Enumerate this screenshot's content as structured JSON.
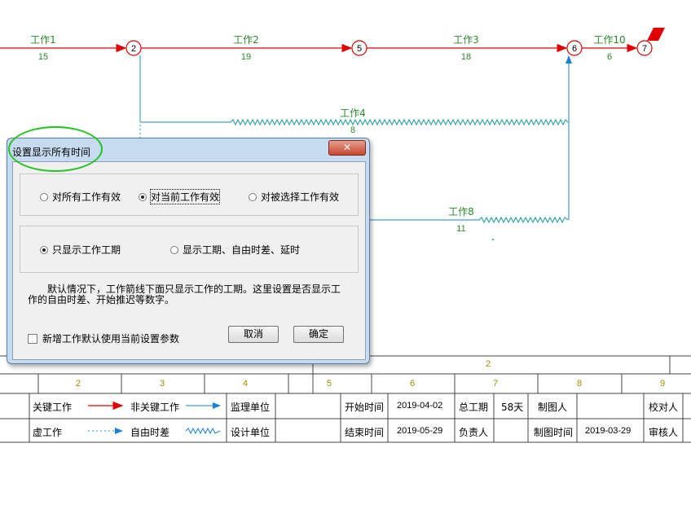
{
  "network": {
    "nodes": [
      {
        "id": "2"
      },
      {
        "id": "5"
      },
      {
        "id": "6"
      },
      {
        "id": "7"
      }
    ],
    "works": [
      {
        "name": "工作1",
        "duration": "15"
      },
      {
        "name": "工作2",
        "duration": "19"
      },
      {
        "name": "工作3",
        "duration": "18"
      },
      {
        "name": "工作10",
        "duration": "6"
      },
      {
        "name": "工作4",
        "duration": "8"
      },
      {
        "name": "工作8",
        "duration": "11"
      }
    ]
  },
  "timescale": {
    "top_label": "2",
    "numbers": [
      "2",
      "3",
      "4",
      "5",
      "6",
      "7",
      "8",
      "9"
    ]
  },
  "legend": {
    "critical_work": "关键工作",
    "non_critical_work": "非关键工作",
    "virtual_work": "虚工作",
    "free_float": "自由时差",
    "supervisor_unit": "监理单位",
    "design_unit": "设计单位",
    "start_time_label": "开始时间",
    "start_time": "2019-04-02",
    "end_time_label": "结束时间",
    "end_time": "2019-05-29",
    "total_duration_label": "总工期",
    "total_duration": "58天",
    "responsible_label": "负责人",
    "drafter_label": "制图人",
    "draft_time_label": "制图时间",
    "draft_time": "2019-03-29",
    "checker_label": "校对人",
    "reviewer_label": "审核人"
  },
  "colors": {
    "critical": "#e00000",
    "noncritical": "#1a7fd6",
    "work_text": "#2a8a2a",
    "scale_text": "#a08a00",
    "annotation": "#22c322"
  },
  "dialog": {
    "title": "设置显示所有时间",
    "close_icon": "close-x",
    "close_glyph": "✕",
    "scope_options": [
      {
        "label": "对所有工作有效",
        "selected": false
      },
      {
        "label": "对当前工作有效",
        "selected": true
      },
      {
        "label": "对被选择工作有效",
        "selected": false
      }
    ],
    "display_options": [
      {
        "label": "只显示工作工期",
        "selected": true
      },
      {
        "label": "显示工期、自由时差、延时",
        "selected": false
      }
    ],
    "note_line1": "　　默认情况下，工作箭线下面只显示工作的工期。这里设置是否显示工",
    "note_line2": "作的自由时差、开始推迟等数字。",
    "default_checkbox_label": "新增工作默认使用当前设置参数",
    "default_checkbox_checked": false,
    "cancel_label": "取消",
    "ok_label": "确定"
  }
}
